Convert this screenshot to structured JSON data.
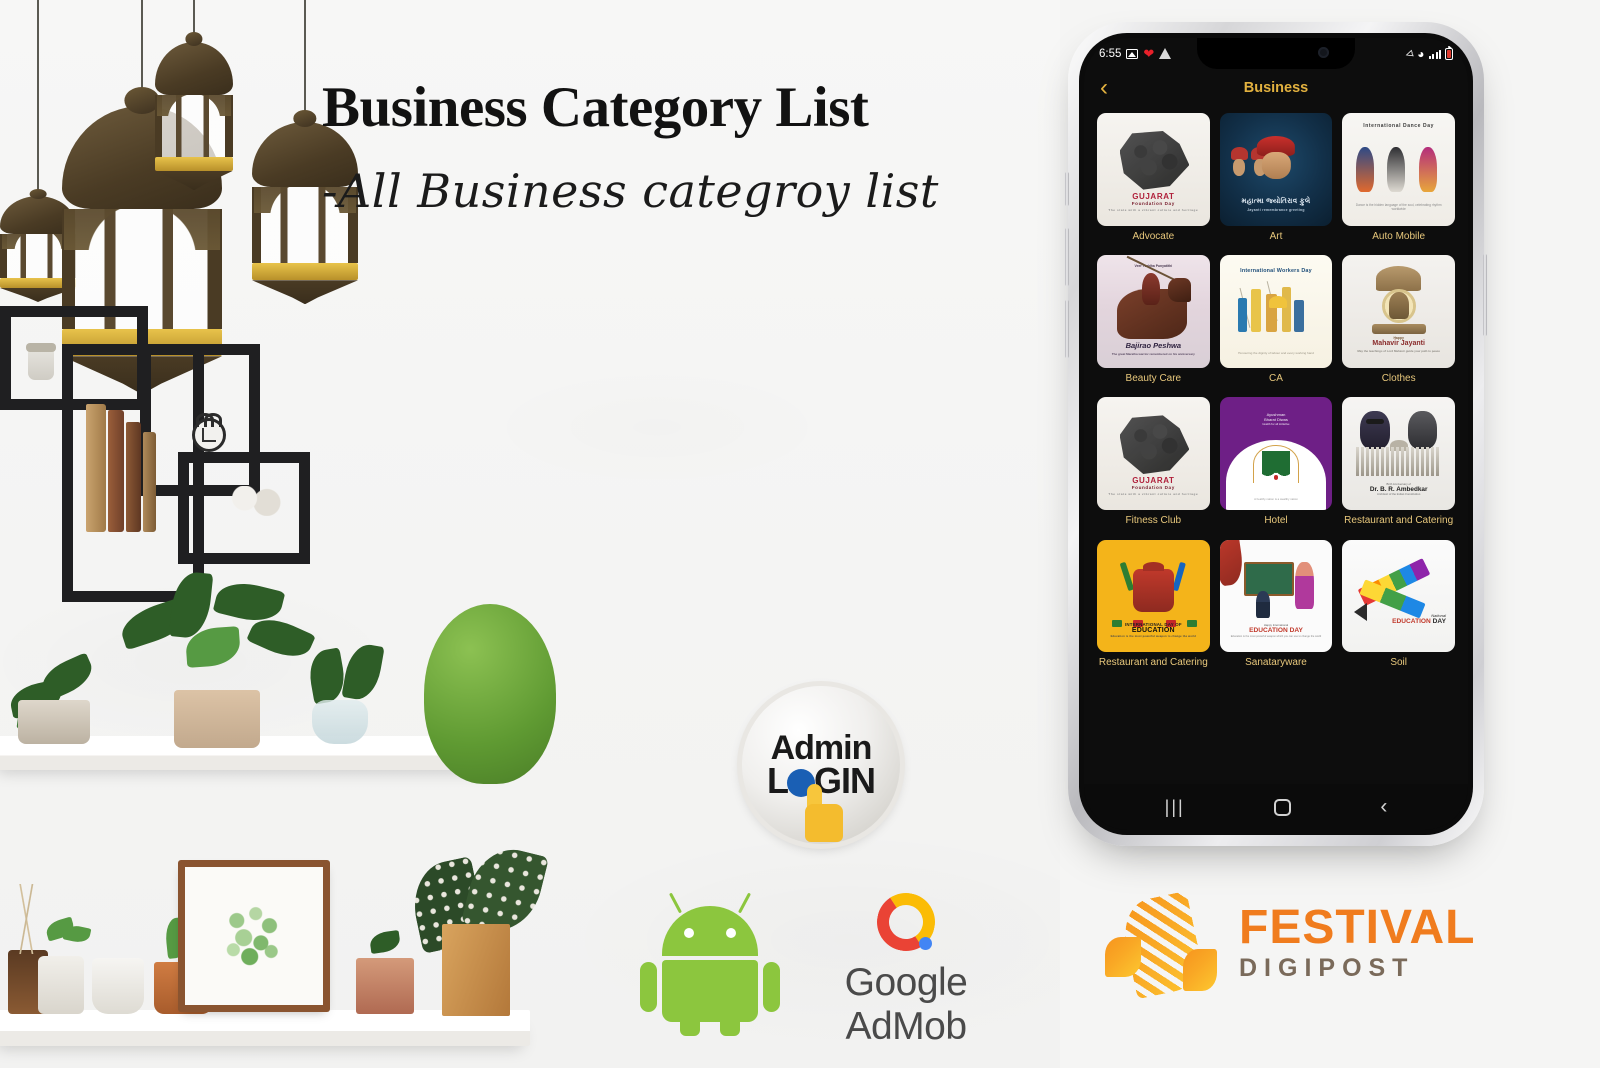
{
  "promo": {
    "headline": "Business Category List",
    "subheadline": "-All Business categroy list",
    "admin_badge": {
      "line1": "Admin",
      "line2_pre": "L",
      "line2_o": "O",
      "line2_post": "GIN"
    },
    "android_label": "android-robot",
    "admob_text": "Google AdMob",
    "festival": {
      "name": "FESTIVAL",
      "sub": "DIGIPOST"
    },
    "colors": {
      "background": "#F5F5F4",
      "accent_gold": "#E2B13F",
      "label_gold": "#E8C87C",
      "android_green": "#8CC63E",
      "admob_red": "#EA4335",
      "admob_yellow": "#FBBC05",
      "admob_blue": "#4285F4",
      "festival_orange": "#F07C1E",
      "festival_grey": "#7A6A5A",
      "login_blue": "#1A5FB4",
      "hand_yellow": "#F4BC2E"
    }
  },
  "phone": {
    "statusbar": {
      "time": "6:55",
      "left_icons": [
        "image-icon",
        "heart-icon",
        "triangle-icon"
      ],
      "right_icons": [
        "mute-icon",
        "wifi-icon",
        "signal-icon",
        "battery-icon"
      ]
    },
    "app": {
      "back_label": "‹",
      "title": "Business"
    },
    "categories": [
      {
        "label": "Advocate",
        "art": "p-gujarat"
      },
      {
        "label": "Art",
        "art": "p-art"
      },
      {
        "label": "Auto Mobile",
        "art": "p-dance"
      },
      {
        "label": "Beauty Care",
        "art": "p-warrior"
      },
      {
        "label": "CA",
        "art": "p-workers"
      },
      {
        "label": "Clothes",
        "art": "p-mahavir"
      },
      {
        "label": "Fitness Club",
        "art": "p-gujarat"
      },
      {
        "label": "Hotel",
        "art": "p-ayush"
      },
      {
        "label": "Restaurant and Catering",
        "art": "p-ambed"
      },
      {
        "label": "Restaurant and Catering",
        "art": "p-edu-y"
      },
      {
        "label": "Sanataryware",
        "art": "p-edu-w"
      },
      {
        "label": "Soil",
        "art": "p-pencil"
      }
    ],
    "poster_text": {
      "gujarat": {
        "title": "GUJARAT",
        "sub": "Foundation Day",
        "fine": "The state with a vibrant culture and heritage"
      },
      "art": {
        "title": "મહાત્મા જ્યોતિરાવ ફુલે",
        "fine": "Jayanti remembrance greeting"
      },
      "dance": {
        "title": "International Dance Day",
        "fine": "Dance is the hidden language of the soul, celebrating rhythm worldwide"
      },
      "warrior": {
        "header": "Veer Yoddha Punyatithi",
        "title": "Bajirao Peshwa",
        "fine": "The great Maratha warrior remembered on his anniversary"
      },
      "workers": {
        "title": "International Workers Day",
        "fine": "Honouring the dignity of labour and every working hand"
      },
      "mahavir": {
        "pre": "Happy",
        "title": "Mahavir Jayanti",
        "fine": "May the teachings of Lord Mahavir guide your path to peace"
      },
      "ayushman": {
        "title": "Ayushman",
        "sub": "Bharat Diwas",
        "fine2": "Health for all initiative",
        "fine": "A healthy nation is a wealthy nation"
      },
      "ambedkar": {
        "pre": "Birth Anniversary of",
        "title": "Dr. B. R. Ambedkar",
        "fine": "Architect of the Indian Constitution"
      },
      "edu_yellow": {
        "pre": "INTERNATIONAL DAY OF",
        "title": "EDUCATION",
        "fine": "Education is the most powerful weapon to change the world"
      },
      "edu_white": {
        "pre": "Happy International",
        "title": "EDUCATION DAY",
        "fine": "Education is the most powerful weapon which you can use to change the world"
      },
      "pencil": {
        "pre": "National",
        "title_a": "EDUCATION",
        "title_b": " DAY"
      }
    },
    "navbar": {
      "recents": "recents-icon",
      "home": "home-icon",
      "back": "back-icon"
    }
  }
}
